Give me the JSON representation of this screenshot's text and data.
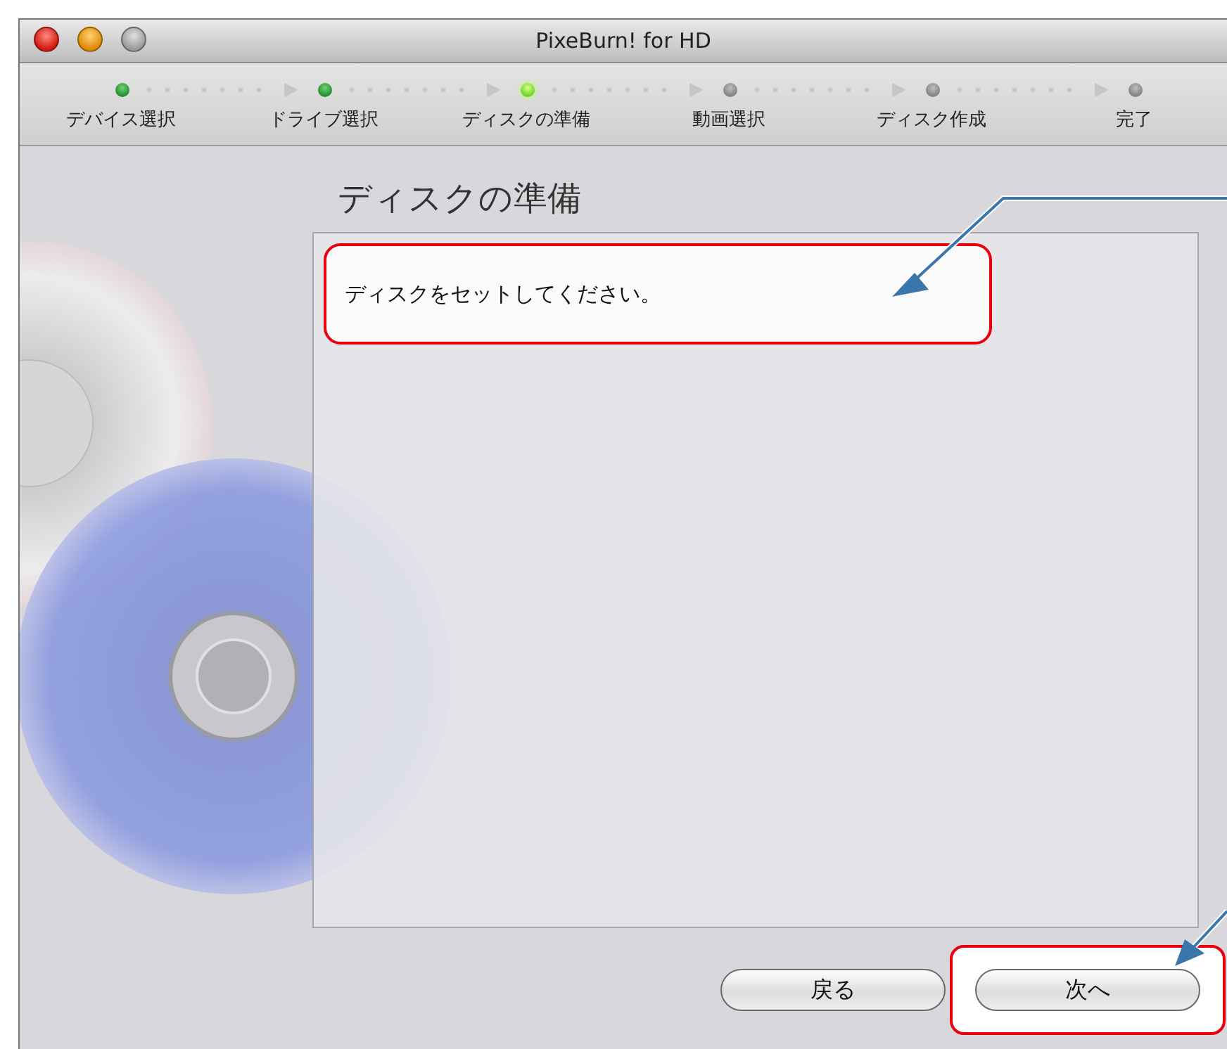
{
  "window": {
    "title": "PixeBurn! for HD"
  },
  "steps": [
    {
      "label": "デバイス選択",
      "done": true,
      "selected": false
    },
    {
      "label": "ドライブ選択",
      "done": true,
      "selected": false
    },
    {
      "label": "ディスクの準備",
      "done": false,
      "selected": true
    },
    {
      "label": "動画選択",
      "done": false,
      "selected": false
    },
    {
      "label": "ディスク作成",
      "done": false,
      "selected": false
    },
    {
      "label": "完了",
      "done": false,
      "selected": false
    }
  ],
  "heading": "ディスクの準備",
  "message": "ディスクをセットしてください。",
  "buttons": [
    {
      "label": "戻る",
      "highlighted": false
    },
    {
      "label": "次へ",
      "highlighted": true
    }
  ]
}
